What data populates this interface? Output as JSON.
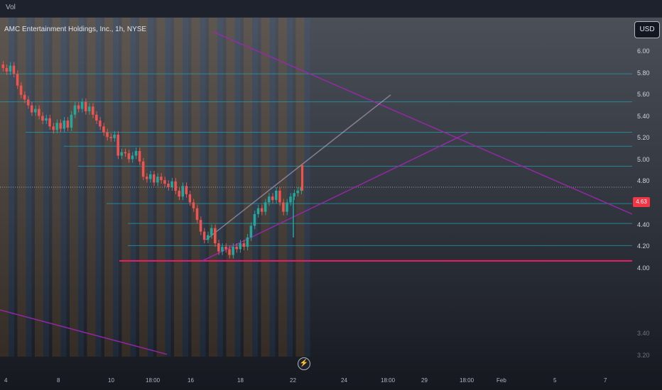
{
  "header": {
    "vol_label": "Vol"
  },
  "symbol": {
    "title": "AMC Entertainment Holdings, Inc., 1h, NYSE"
  },
  "currency_button": "USD",
  "price_axis": {
    "labels": [
      "6.00",
      "5.80",
      "5.60",
      "5.40",
      "5.20",
      "5.00",
      "4.80",
      "4.40",
      "4.20",
      "4.00",
      "3.40",
      "3.20"
    ],
    "last_price": "4.63",
    "last_price_color": "#f23645"
  },
  "time_axis": {
    "labels": [
      "4",
      "8",
      "10",
      "18:00",
      "16",
      "18",
      "22",
      "24",
      "18:00",
      "29",
      "18:00",
      "Feb",
      "5",
      "7"
    ]
  },
  "lightning_icon": "lightning-icon",
  "colors": {
    "up": "#26a69a",
    "down": "#ef5350",
    "support": "#e91e63",
    "trend": "#9c27b0",
    "level": "#22a6b3"
  },
  "chart_data": {
    "type": "candlestick",
    "symbol": "AMC",
    "interval": "1h",
    "exchange": "NYSE",
    "currency": "USD",
    "ylim": [
      3.18,
      6.08
    ],
    "last_price": 4.63,
    "close_series": [
      5.65,
      5.62,
      5.67,
      5.6,
      5.5,
      5.42,
      5.38,
      5.33,
      5.27,
      5.3,
      5.24,
      5.2,
      5.22,
      5.15,
      5.12,
      5.18,
      5.13,
      5.2,
      5.14,
      5.25,
      5.33,
      5.3,
      5.36,
      5.28,
      5.32,
      5.25,
      5.2,
      5.15,
      5.1,
      5.06,
      5.05,
      5.08,
      4.9,
      4.93,
      4.92,
      4.87,
      4.9,
      4.94,
      4.85,
      4.72,
      4.7,
      4.74,
      4.67,
      4.72,
      4.69,
      4.66,
      4.63,
      4.68,
      4.6,
      4.55,
      4.64,
      4.57,
      4.5,
      4.45,
      4.35,
      4.25,
      4.18,
      4.22,
      4.28,
      4.15,
      4.08,
      4.12,
      4.1,
      4.05,
      4.12,
      4.1,
      4.15,
      4.12,
      4.2,
      4.3,
      4.4,
      4.45,
      4.42,
      4.5,
      4.55,
      4.52,
      4.6,
      4.5,
      4.42,
      4.5,
      4.55,
      4.58,
      4.6,
      4.63
    ],
    "horizontal_levels": [
      5.6,
      5.36,
      5.1,
      4.98,
      4.81,
      4.49,
      4.32,
      4.13
    ],
    "support_level": 4.0,
    "trendlines": [
      {
        "from": [
          300,
          5.96
        ],
        "to": [
          890,
          4.4
        ]
      },
      {
        "from": [
          285,
          4.0
        ],
        "to": [
          660,
          5.1
        ]
      },
      {
        "from": [
          290,
          4.18
        ],
        "to": [
          550,
          5.42
        ]
      },
      {
        "from": [
          0,
          3.58
        ],
        "to": [
          235,
          3.2
        ]
      }
    ]
  }
}
